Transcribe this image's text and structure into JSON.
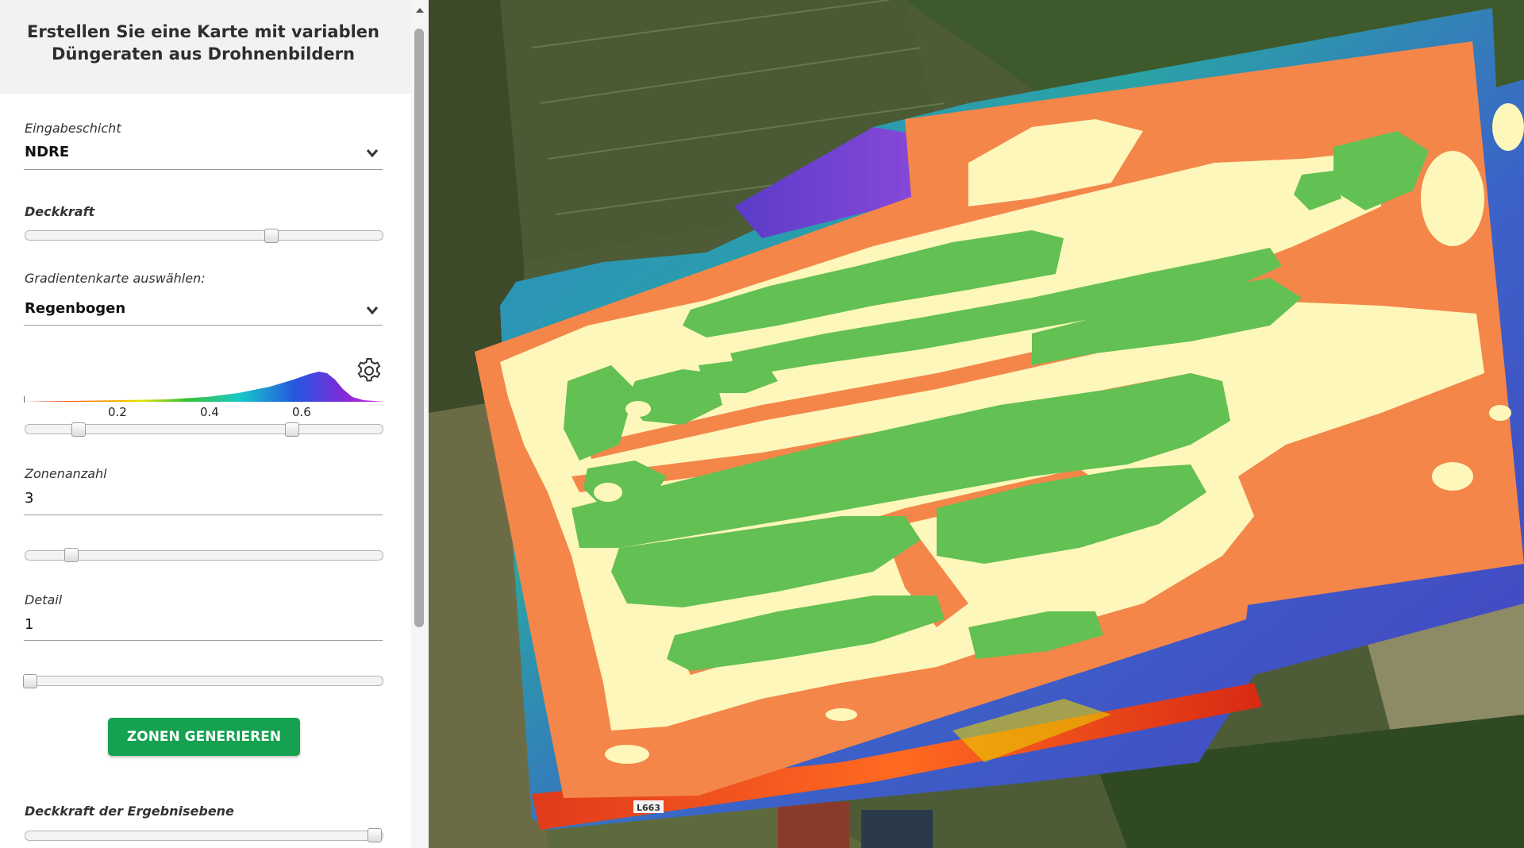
{
  "panel": {
    "title_line1": "Erstellen Sie eine Karte mit variablen",
    "title_line2": "Düngeraten aus Drohnenbildern",
    "input_layer": {
      "label": "Eingabeschicht",
      "value": "NDRE"
    },
    "opacity": {
      "label": "Deckkraft",
      "value": 0.7
    },
    "gradient": {
      "label": "Gradientenkarte auswählen:",
      "value": "Regenbogen"
    },
    "histogram": {
      "ticks": [
        "0.2",
        "0.4",
        "0.6"
      ],
      "range_min": 0.14,
      "range_max": 0.76,
      "gear_icon": "gear-icon"
    },
    "zones": {
      "label": "Zonenanzahl",
      "value": "3",
      "slider": 0.12
    },
    "detail": {
      "label": "Detail",
      "value": "1",
      "slider": 0.0
    },
    "generate_button": "ZONEN GENERIEREN",
    "result_opacity": {
      "label": "Deckkraft der Ergebnisebene",
      "value": 1.0
    }
  },
  "map": {
    "zone_colors": {
      "low": "#f4864a",
      "mid": "#fdf7bb",
      "high": "#63c052"
    },
    "road_label": "L663"
  },
  "colors": {
    "accent_green": "#15a150",
    "header_bg": "#f2f2f2"
  }
}
